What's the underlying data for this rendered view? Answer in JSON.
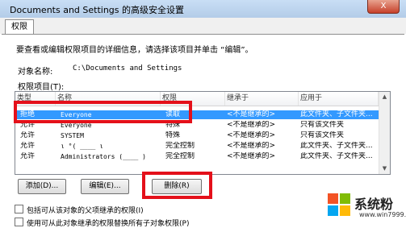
{
  "window": {
    "title": "Documents and Settings 的高级安全设置",
    "close_label": "X"
  },
  "tabs": [
    {
      "label": "权限"
    }
  ],
  "instructions": "要查看或编辑权限项目的详细信息，请选择该项目并单击 “编辑”。",
  "object_name": {
    "label": "对象名称:",
    "value": "C:\\Documents and Settings"
  },
  "entries_label": "权限项目(T):",
  "columns": [
    "类型",
    "名称",
    "权限",
    "继承于",
    "应用于"
  ],
  "rows": [
    {
      "type": "拒绝",
      "name": "Everyone",
      "permission": "读取",
      "inherited": "<不是继承的>",
      "applies_to": "此文件夹、子文件夹...",
      "selected": true
    },
    {
      "type": "允许",
      "name": "Everyone",
      "permission": "特殊",
      "inherited": "<不是继承的>",
      "applies_to": "只有该文件夹",
      "selected": false
    },
    {
      "type": "允许",
      "name": "SYSTEM",
      "permission": "特殊",
      "inherited": "<不是继承的>",
      "applies_to": "只有该文件夹",
      "selected": false
    },
    {
      "type": "允许",
      "name": "ι °( ____ ι",
      "permission": "完全控制",
      "inherited": "<不是继承的>",
      "applies_to": "此文件夹、子文件夹...",
      "selected": false
    },
    {
      "type": "允许",
      "name": "Administrators (____ )",
      "permission": "完全控制",
      "inherited": "<不是继承的>",
      "applies_to": "此文件夹、子文件夹...",
      "selected": false
    }
  ],
  "buttons": {
    "add": "添加(D)...",
    "edit": "编辑(E)...",
    "delete": "删除(R)"
  },
  "checkboxes": [
    {
      "label": "包括可从该对象的父项继承的权限(I)",
      "checked": false
    },
    {
      "label": "使用可从此对象继承的权限替换所有子对象权限(P)",
      "checked": false
    }
  ],
  "watermark": {
    "brand": "系统粉",
    "url": "www.win7999.com"
  },
  "colors": {
    "selection": "#3399ff",
    "highlight_box": "#e4101a"
  }
}
